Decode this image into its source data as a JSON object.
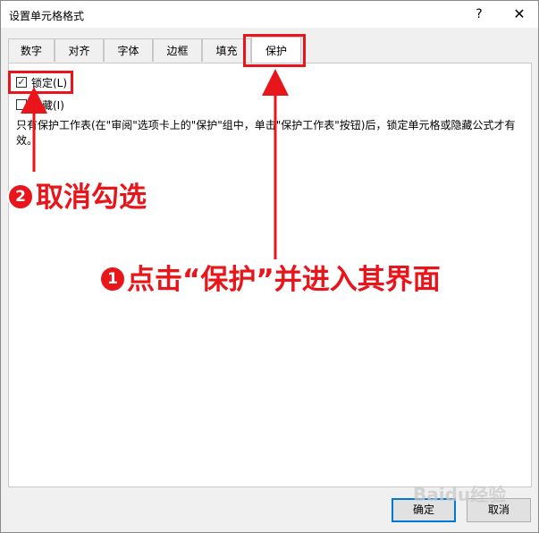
{
  "window": {
    "title": "设置单元格格式",
    "help_label": "?",
    "close_label": "✕"
  },
  "tabs": [
    {
      "label": "数字",
      "active": false
    },
    {
      "label": "对齐",
      "active": false
    },
    {
      "label": "字体",
      "active": false
    },
    {
      "label": "边框",
      "active": false
    },
    {
      "label": "填充",
      "active": false
    },
    {
      "label": "保护",
      "active": true
    }
  ],
  "protection": {
    "locked": {
      "label": "锁定(L)",
      "checked": true
    },
    "hidden": {
      "label": "隐藏(I)",
      "checked": false
    },
    "description": "只有保护工作表(在\"审阅\"选项卡上的\"保护\"组中，单击\"保护工作表\"按钮)后，锁定单元格或隐藏公式才有效。"
  },
  "buttons": {
    "ok": "确定",
    "cancel": "取消"
  },
  "annotations": {
    "step1_number": "1",
    "step1_text": "点击“保护”并进入其界面",
    "step2_number": "2",
    "step2_text": "取消勾选",
    "color": "#e8161b"
  },
  "watermark": "Baidu经验"
}
